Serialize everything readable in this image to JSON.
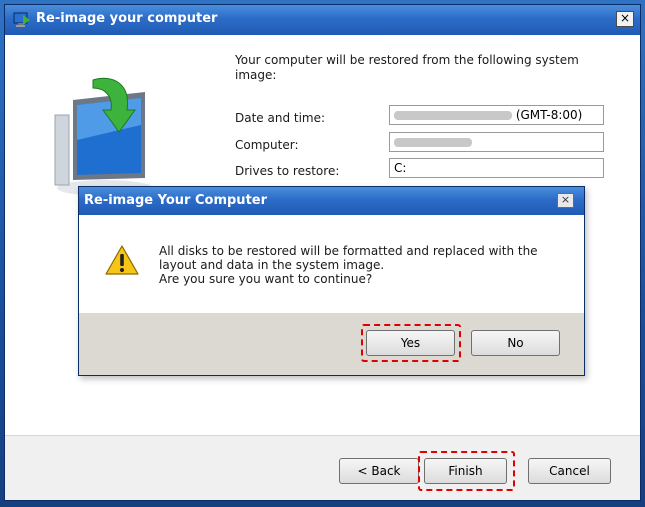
{
  "window": {
    "title": "Re-image your computer",
    "close_glyph": "×",
    "intro": "Your computer will be restored from the following system image:",
    "fields": [
      {
        "label": "Date and time:",
        "value_suffix": "(GMT-8:00)"
      },
      {
        "label": "Computer:",
        "value": ""
      },
      {
        "label": "Drives to restore:",
        "value": "C:"
      }
    ],
    "buttons": {
      "back": "< Back",
      "finish": "Finish",
      "cancel": "Cancel"
    }
  },
  "dialog": {
    "title": "Re-image Your Computer",
    "close_glyph": "×",
    "message_line1": "All disks to be restored will be formatted and replaced with the",
    "message_line2": "layout and data in the system image.",
    "message_line3": "Are you sure you want to continue?",
    "buttons": {
      "yes": "Yes",
      "no": "No"
    }
  },
  "colors": {
    "titlebar": "#2c6cc8",
    "highlight": "#e00000",
    "dialog_footer": "#dcd8d2",
    "window_footer": "#f0f0f0"
  },
  "icons": {
    "window": "computer-restore-icon",
    "illustration": "computer-monitor-arrow-icon",
    "warning": "warning-triangle-icon"
  }
}
